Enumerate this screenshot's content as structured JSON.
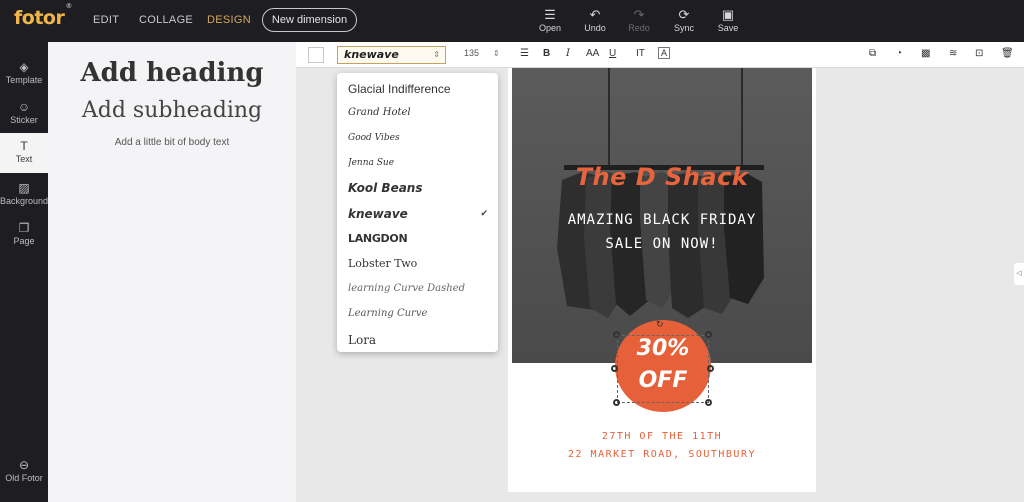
{
  "app": {
    "logo": "fotor",
    "logo_mark": "®"
  },
  "nav": {
    "edit": "EDIT",
    "collage": "COLLAGE",
    "design": "DESIGN",
    "new_dimension": "New dimension"
  },
  "tools": [
    {
      "label": "Open",
      "icon": "menu-icon"
    },
    {
      "label": "Undo",
      "icon": "undo-icon"
    },
    {
      "label": "Redo",
      "icon": "redo-icon"
    },
    {
      "label": "Sync",
      "icon": "sync-icon"
    },
    {
      "label": "Save",
      "icon": "save-icon"
    }
  ],
  "sidebar": {
    "items": [
      {
        "label": "Template",
        "icon": "layers-icon"
      },
      {
        "label": "Sticker",
        "icon": "sticker-icon"
      },
      {
        "label": "Text",
        "icon": "text-icon"
      },
      {
        "label": "Background",
        "icon": "background-icon"
      },
      {
        "label": "Page",
        "icon": "page-icon"
      }
    ],
    "old_fotor": "Old Fotor"
  },
  "text_panel": {
    "heading": "Add heading",
    "subheading": "Add subheading",
    "body": "Add a little bit of body text"
  },
  "toolbar": {
    "font_value": "knewave",
    "size_value": "135",
    "bold": "B",
    "italic": "I",
    "case": "AA",
    "underline": "U",
    "spacing": "IT",
    "text_bg": "A"
  },
  "font_dropdown": {
    "items": [
      "Glacial Indifference",
      "Grand Hotel",
      "Good Vibes",
      "Jenna Sue",
      "Kool Beans",
      "knewave",
      "LANGDON",
      "Lobster Two",
      "learning Curve Dashed",
      "Learning Curve",
      "Lora"
    ],
    "selected": "knewave",
    "check": "✔"
  },
  "design": {
    "headline": "The D Shack",
    "promo_line1": "AMAZING BLACK FRIDAY",
    "promo_line2": "SALE ON NOW!",
    "discount_line1": "30%",
    "discount_line2": "OFF",
    "date": "27TH OF THE 11TH",
    "address": "22 MARKET ROAD, SOUTHBURY"
  },
  "colors": {
    "accent": "#e6613a",
    "brand": "#f0b54a",
    "dark": "#1d1d22"
  }
}
